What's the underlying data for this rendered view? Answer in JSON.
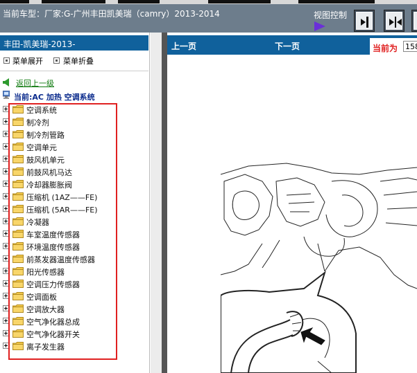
{
  "header": {
    "title": "当前车型：厂家:G-广州丰田凯美瑞（camry）2013-2014",
    "view_control_label": "视图控制"
  },
  "left_panel": {
    "model_label": "丰田-凯美瑞-2013-",
    "expand_label": "菜单展开",
    "collapse_label": "菜单折叠",
    "back_label": "返回上一级",
    "current_label": "当前:AC 加热 空调系统"
  },
  "tree": {
    "items": [
      {
        "label": "空调系统"
      },
      {
        "label": "制冷剂"
      },
      {
        "label": "制冷剂管路"
      },
      {
        "label": "空调单元"
      },
      {
        "label": "鼓风机单元"
      },
      {
        "label": "前鼓风机马达"
      },
      {
        "label": "冷却器膨胀阀"
      },
      {
        "label": "压缩机 (1AZ——FE)"
      },
      {
        "label": "压缩机 (5AR——FE)"
      },
      {
        "label": "冷凝器"
      },
      {
        "label": "车室温度传感器"
      },
      {
        "label": "环境温度传感器"
      },
      {
        "label": "前蒸发器温度传感器"
      },
      {
        "label": "阳光传感器"
      },
      {
        "label": "空调压力传感器"
      },
      {
        "label": "空调面板"
      },
      {
        "label": "空调放大器"
      },
      {
        "label": "空气净化器总成"
      },
      {
        "label": "空气净化器开关"
      },
      {
        "label": "离子发生器"
      }
    ]
  },
  "right_panel": {
    "prev_label": "上一页",
    "next_label": "下一页",
    "current_page_label": "当前为",
    "current_page_value": "158"
  },
  "colors": {
    "header_bg": "#6d7d8c",
    "bar_blue": "#10619c",
    "highlight_red": "#e02020",
    "link_green": "#0f7a0f"
  },
  "icons": {
    "view_buttons": [
      "single-page-icon",
      "double-page-icon",
      "extra-view-icon"
    ],
    "folder": "folder-icon"
  }
}
